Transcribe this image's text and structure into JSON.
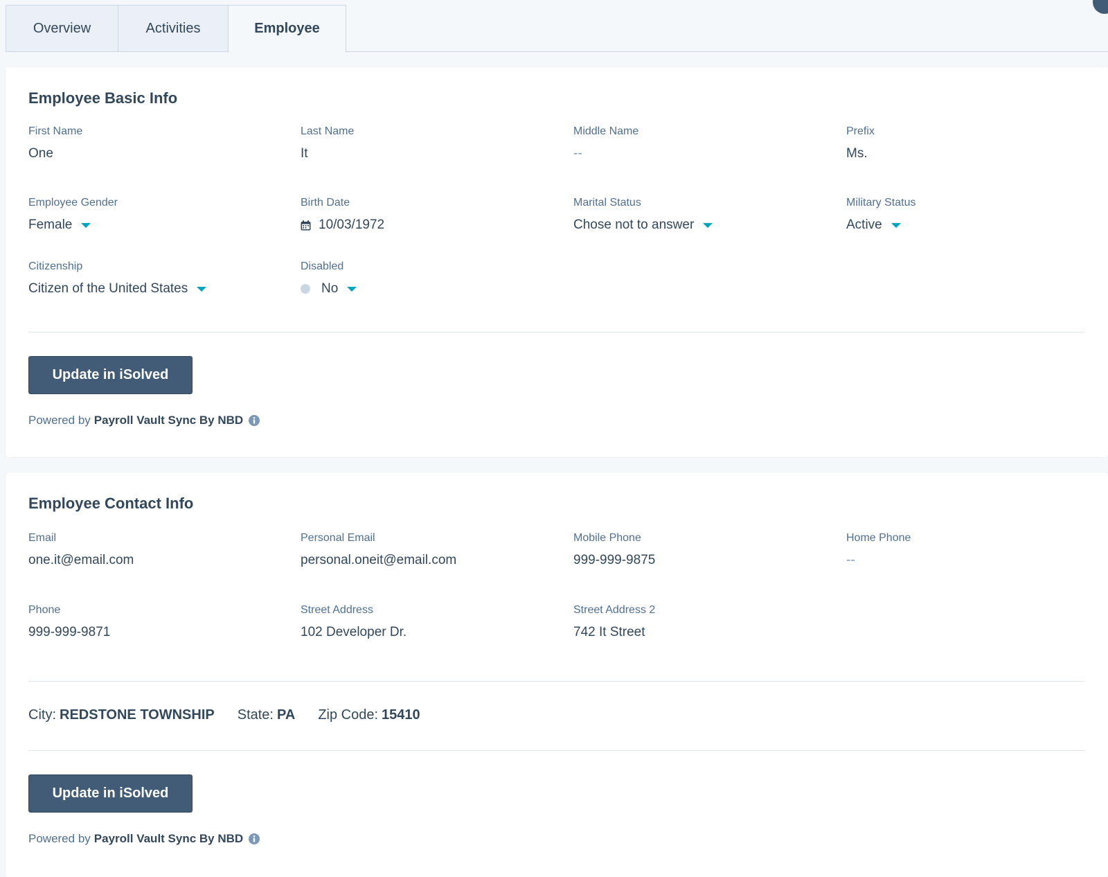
{
  "tabs": [
    {
      "label": "Overview"
    },
    {
      "label": "Activities"
    },
    {
      "label": "Employee"
    }
  ],
  "basic_info": {
    "title": "Employee Basic Info",
    "first_name": {
      "label": "First Name",
      "value": "One"
    },
    "last_name": {
      "label": "Last Name",
      "value": "It"
    },
    "middle_name": {
      "label": "Middle Name",
      "value": "--"
    },
    "prefix": {
      "label": "Prefix",
      "value": "Ms."
    },
    "gender": {
      "label": "Employee Gender",
      "value": "Female"
    },
    "birth_date": {
      "label": "Birth Date",
      "value": "10/03/1972"
    },
    "marital_status": {
      "label": "Marital Status",
      "value": "Chose not to answer"
    },
    "military_status": {
      "label": "Military Status",
      "value": "Active"
    },
    "citizenship": {
      "label": "Citizenship",
      "value": "Citizen of the United States"
    },
    "disabled": {
      "label": "Disabled",
      "value": "No"
    },
    "update_button": "Update in iSolved",
    "powered_by": "Powered by",
    "powered_brand": "Payroll Vault Sync By NBD"
  },
  "contact_info": {
    "title": "Employee Contact Info",
    "email": {
      "label": "Email",
      "value": "one.it@email.com"
    },
    "personal_email": {
      "label": "Personal Email",
      "value": "personal.oneit@email.com"
    },
    "mobile_phone": {
      "label": "Mobile Phone",
      "value": "999-999-9875"
    },
    "home_phone": {
      "label": "Home Phone",
      "value": "--"
    },
    "phone": {
      "label": "Phone",
      "value": "999-999-9871"
    },
    "street_address": {
      "label": "Street Address",
      "value": "102 Developer Dr."
    },
    "street_address_2": {
      "label": "Street Address 2",
      "value": "742 It Street"
    },
    "city": {
      "label": "City:",
      "value": "REDSTONE TOWNSHIP"
    },
    "state": {
      "label": "State:",
      "value": "PA"
    },
    "zip": {
      "label": "Zip Code:",
      "value": "15410"
    },
    "update_button": "Update in iSolved",
    "powered_by": "Powered by",
    "powered_brand": "Payroll Vault Sync By NBD"
  },
  "icons": {
    "dropdown": "chevron-down-icon",
    "calendar": "calendar-icon",
    "info": "info-icon",
    "status_dot": "status-dot-icon"
  },
  "colors": {
    "accent": "#00a4bd",
    "button": "#425b76",
    "text": "#33475b",
    "label": "#516f90"
  }
}
